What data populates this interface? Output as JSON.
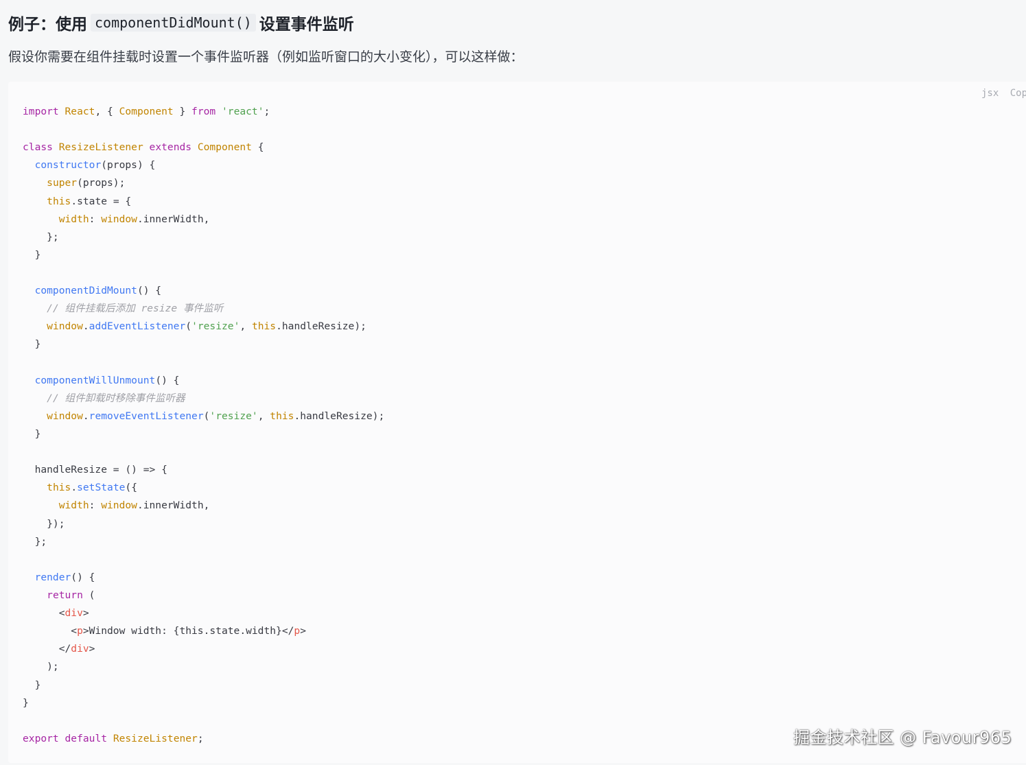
{
  "heading": {
    "prefix": "例子：使用",
    "code": "componentDidMount()",
    "suffix": "设置事件监听"
  },
  "intro": "假设你需要在组件挂载时设置一个事件监听器（例如监听窗口的大小变化），可以这样做：",
  "code_block": {
    "language": "jsx",
    "copy_label": "Copy",
    "token_colors": {
      "kw": "#a626a4",
      "tp": "#c18401",
      "str": "#50a14f",
      "fn": "#4078f2",
      "cm": "#a0a1a7",
      "tag": "#e45649",
      "pl": "#383a42"
    },
    "lines": [
      [
        [
          "kw",
          "import"
        ],
        [
          "pl",
          " "
        ],
        [
          "tp",
          "React"
        ],
        [
          "pl",
          ", { "
        ],
        [
          "tp",
          "Component"
        ],
        [
          "pl",
          " } "
        ],
        [
          "kw",
          "from"
        ],
        [
          "pl",
          " "
        ],
        [
          "str",
          "'react'"
        ],
        [
          "pl",
          ";"
        ]
      ],
      [],
      [
        [
          "kw",
          "class"
        ],
        [
          "pl",
          " "
        ],
        [
          "tp",
          "ResizeListener"
        ],
        [
          "pl",
          " "
        ],
        [
          "kw",
          "extends"
        ],
        [
          "pl",
          " "
        ],
        [
          "tp",
          "Component"
        ],
        [
          "pl",
          " {"
        ]
      ],
      [
        [
          "pl",
          "  "
        ],
        [
          "fn",
          "constructor"
        ],
        [
          "pl",
          "(props) {"
        ]
      ],
      [
        [
          "pl",
          "    "
        ],
        [
          "tp",
          "super"
        ],
        [
          "pl",
          "(props);"
        ]
      ],
      [
        [
          "pl",
          "    "
        ],
        [
          "tp",
          "this"
        ],
        [
          "pl",
          ".state = {"
        ]
      ],
      [
        [
          "pl",
          "      "
        ],
        [
          "tp",
          "width"
        ],
        [
          "pl",
          ": "
        ],
        [
          "tp",
          "window"
        ],
        [
          "pl",
          ".innerWidth,"
        ]
      ],
      [
        [
          "pl",
          "    };"
        ]
      ],
      [
        [
          "pl",
          "  }"
        ]
      ],
      [],
      [
        [
          "pl",
          "  "
        ],
        [
          "fn",
          "componentDidMount"
        ],
        [
          "pl",
          "() {"
        ]
      ],
      [
        [
          "pl",
          "    "
        ],
        [
          "cm",
          "// 组件挂载后添加 resize 事件监听"
        ]
      ],
      [
        [
          "pl",
          "    "
        ],
        [
          "tp",
          "window"
        ],
        [
          "pl",
          "."
        ],
        [
          "fn",
          "addEventListener"
        ],
        [
          "pl",
          "("
        ],
        [
          "str",
          "'resize'"
        ],
        [
          "pl",
          ", "
        ],
        [
          "tp",
          "this"
        ],
        [
          "pl",
          ".handleResize);"
        ]
      ],
      [
        [
          "pl",
          "  }"
        ]
      ],
      [],
      [
        [
          "pl",
          "  "
        ],
        [
          "fn",
          "componentWillUnmount"
        ],
        [
          "pl",
          "() {"
        ]
      ],
      [
        [
          "pl",
          "    "
        ],
        [
          "cm",
          "// 组件卸载时移除事件监听器"
        ]
      ],
      [
        [
          "pl",
          "    "
        ],
        [
          "tp",
          "window"
        ],
        [
          "pl",
          "."
        ],
        [
          "fn",
          "removeEventListener"
        ],
        [
          "pl",
          "("
        ],
        [
          "str",
          "'resize'"
        ],
        [
          "pl",
          ", "
        ],
        [
          "tp",
          "this"
        ],
        [
          "pl",
          ".handleResize);"
        ]
      ],
      [
        [
          "pl",
          "  }"
        ]
      ],
      [],
      [
        [
          "pl",
          "  handleResize = () => {"
        ]
      ],
      [
        [
          "pl",
          "    "
        ],
        [
          "tp",
          "this"
        ],
        [
          "pl",
          "."
        ],
        [
          "fn",
          "setState"
        ],
        [
          "pl",
          "({"
        ]
      ],
      [
        [
          "pl",
          "      "
        ],
        [
          "tp",
          "width"
        ],
        [
          "pl",
          ": "
        ],
        [
          "tp",
          "window"
        ],
        [
          "pl",
          ".innerWidth,"
        ]
      ],
      [
        [
          "pl",
          "    });"
        ]
      ],
      [
        [
          "pl",
          "  };"
        ]
      ],
      [],
      [
        [
          "pl",
          "  "
        ],
        [
          "fn",
          "render"
        ],
        [
          "pl",
          "() {"
        ]
      ],
      [
        [
          "pl",
          "    "
        ],
        [
          "kw",
          "return"
        ],
        [
          "pl",
          " ("
        ]
      ],
      [
        [
          "pl",
          "      <"
        ],
        [
          "tag",
          "div"
        ],
        [
          "pl",
          ">"
        ]
      ],
      [
        [
          "pl",
          "        <"
        ],
        [
          "tag",
          "p"
        ],
        [
          "pl",
          ">Window width: {this.state.width}</"
        ],
        [
          "tag",
          "p"
        ],
        [
          "pl",
          ">"
        ]
      ],
      [
        [
          "pl",
          "      </"
        ],
        [
          "tag",
          "div"
        ],
        [
          "pl",
          ">"
        ]
      ],
      [
        [
          "pl",
          "    );"
        ]
      ],
      [
        [
          "pl",
          "  }"
        ]
      ],
      [
        [
          "pl",
          "}"
        ]
      ],
      [],
      [
        [
          "kw",
          "export"
        ],
        [
          "pl",
          " "
        ],
        [
          "kw",
          "default"
        ],
        [
          "pl",
          " "
        ],
        [
          "tp",
          "ResizeListener"
        ],
        [
          "pl",
          ";"
        ]
      ]
    ]
  },
  "watermark": "掘金技术社区 @ Favour965"
}
